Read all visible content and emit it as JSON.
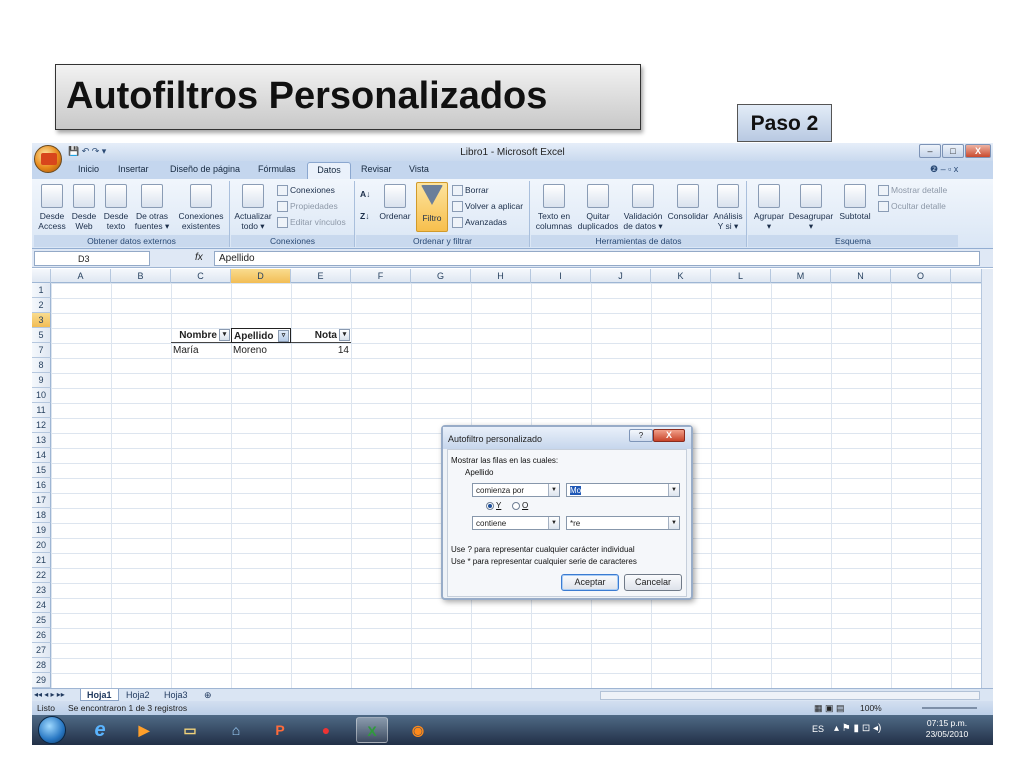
{
  "slide": {
    "title": "Autofiltros Personalizados",
    "step": "Paso 2"
  },
  "window": {
    "title": "Libro1 - Microsoft Excel",
    "btn_min": "–",
    "btn_max": "□",
    "btn_close": "X"
  },
  "ribbon": {
    "tabs": [
      "Inicio",
      "Insertar",
      "Diseño de página",
      "Fórmulas",
      "Datos",
      "Revisar",
      "Vista"
    ],
    "groups": {
      "external": {
        "label": "Obtener datos externos",
        "buttons": [
          [
            "Desde",
            "Access"
          ],
          [
            "Desde",
            "Web"
          ],
          [
            "Desde",
            "texto"
          ],
          [
            "De otras",
            "fuentes ▾"
          ],
          [
            "Conexiones",
            "existentes"
          ]
        ]
      },
      "connections": {
        "label": "Conexiones",
        "refresh": [
          "Actualizar",
          "todo ▾"
        ],
        "items": [
          "Conexiones",
          "Propiedades",
          "Editar vínculos"
        ]
      },
      "sort": {
        "label": "Ordenar y filtrar",
        "sort": "Ordenar",
        "filter": "Filtro",
        "items": [
          "Borrar",
          "Volver a aplicar",
          "Avanzadas"
        ]
      },
      "tools": {
        "label": "Herramientas de datos",
        "buttons": [
          [
            "Texto en",
            "columnas"
          ],
          [
            "Quitar",
            "duplicados"
          ],
          [
            "Validación",
            "de datos ▾"
          ],
          [
            "Consolidar",
            ""
          ],
          [
            "Análisis",
            "Y si ▾"
          ]
        ]
      },
      "outline": {
        "label": "Esquema",
        "buttons": [
          "Agrupar",
          "Desagrupar",
          "Subtotal"
        ],
        "items": [
          "Mostrar detalle",
          "Ocultar detalle"
        ]
      }
    }
  },
  "formula_bar": {
    "name_box": "D3",
    "fx": "fx",
    "value": "Apellido"
  },
  "grid": {
    "columns": [
      "A",
      "B",
      "C",
      "D",
      "E",
      "F",
      "G",
      "H",
      "I",
      "J",
      "K",
      "L",
      "M",
      "N",
      "O"
    ],
    "rows": [
      "1",
      "2",
      "3",
      "5",
      "7",
      "8",
      "9",
      "10",
      "11",
      "12",
      "13",
      "14",
      "15",
      "16",
      "17",
      "18",
      "19",
      "20",
      "21",
      "22",
      "23",
      "24",
      "25",
      "26",
      "27",
      "28",
      "29"
    ],
    "headers": [
      "Nombre",
      "Apellido",
      "Nota"
    ],
    "record": {
      "nombre": "María",
      "apellido": "Moreno",
      "nota": "14"
    }
  },
  "dialog": {
    "title": "Autofiltro personalizado",
    "help": "?",
    "close": "X",
    "intro": "Mostrar las filas en las cuales:",
    "field": "Apellido",
    "op1": "comienza por",
    "val1": "Mo",
    "and_label": "Y",
    "or_label": "O",
    "op2": "contiene",
    "val2": "*re",
    "hint1": "Use ? para representar cualquier carácter individual",
    "hint2": "Use * para representar cualquier serie de caracteres",
    "ok": "Aceptar",
    "cancel": "Cancelar"
  },
  "sheets": [
    "Hoja1",
    "Hoja2",
    "Hoja3"
  ],
  "status": {
    "mode": "Listo",
    "message": "Se encontraron 1 de 3 registros",
    "zoom": "100%"
  },
  "taskbar": {
    "lang": "ES",
    "time": "07:15 p.m.",
    "date": "23/05/2010"
  }
}
